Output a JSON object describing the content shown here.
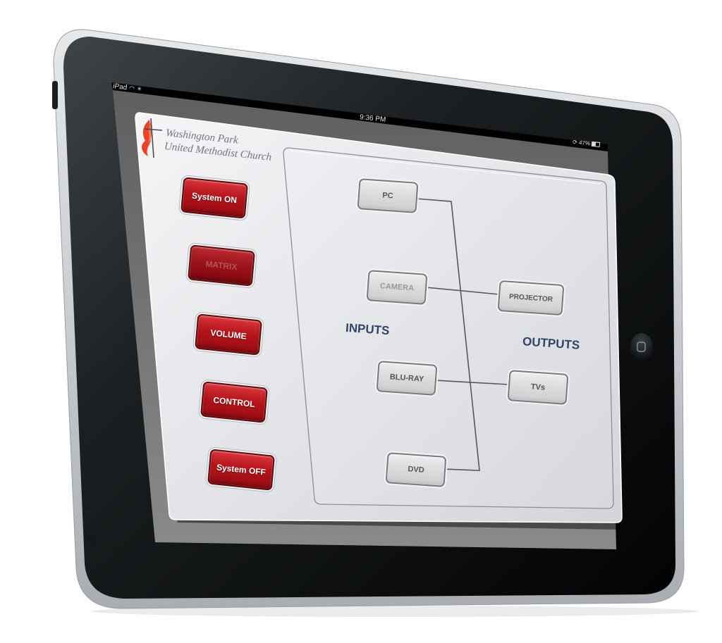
{
  "device": {
    "model_label": "iPad",
    "status_bar": {
      "carrier": "iPad",
      "wifi_icon": "wifi-icon",
      "activity_icon": "activity-spinner-icon",
      "time": "9:36 PM",
      "rotation_lock_icon": "rotation-lock-icon",
      "battery_percent": "47%",
      "battery_icon": "battery-icon",
      "battery_level": 0.47
    },
    "home_button_icon": "home-button-icon"
  },
  "app": {
    "logo_icon": "cross-and-flame-logo-icon",
    "brand": {
      "line1": "Washington Park",
      "line2": "United Methodist Church"
    },
    "sidebar": {
      "buttons": [
        {
          "label": "System ON",
          "state": "active"
        },
        {
          "label": "MATRIX",
          "state": "selected-disabled"
        },
        {
          "label": "VOLUME",
          "state": "active"
        },
        {
          "label": "CONTROL",
          "state": "active"
        },
        {
          "label": "System OFF",
          "state": "active"
        }
      ]
    },
    "matrix": {
      "inputs_label": "INPUTS",
      "outputs_label": "OUTPUTS",
      "inputs": [
        {
          "label": "PC",
          "state": "normal"
        },
        {
          "label": "CAMERA",
          "state": "dim"
        },
        {
          "label": "BLU-RAY",
          "state": "normal"
        },
        {
          "label": "DVD",
          "state": "normal"
        }
      ],
      "outputs": [
        {
          "label": "PROJECTOR",
          "state": "normal"
        },
        {
          "label": "TVs",
          "state": "normal"
        }
      ],
      "routes": [
        {
          "from": "CAMERA",
          "to": "PROJECTOR"
        },
        {
          "from": "BLU-RAY",
          "to": "TVs"
        }
      ],
      "bus_connects": [
        "PC",
        "DVD"
      ]
    },
    "colors": {
      "button_red": "#b4141b",
      "label_navy": "#2f4466",
      "logo_flame": "#e8442a"
    }
  }
}
